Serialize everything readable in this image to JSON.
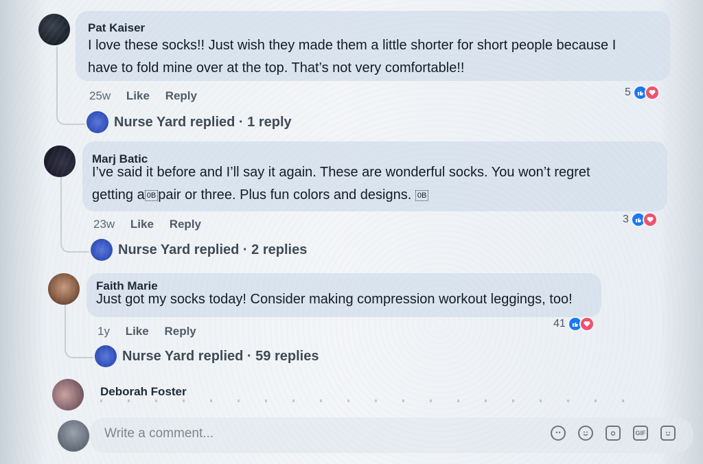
{
  "comments": [
    {
      "author": "Pat Kaiser",
      "text_line1": "I love these socks!! Just wish they made them a little shorter for short people because I",
      "text_line2": "have to fold mine over at the top. That’s not very comfortable!!",
      "time": "25w",
      "like": "Like",
      "reply": "Reply",
      "reaction_count": "5",
      "replies_text": "Nurse Yard replied · 1 reply"
    },
    {
      "author": "Marj Batic",
      "text_line1": "I’ve said it before and I’ll say it again. These are wonderful socks. You won’t regret",
      "text_line2_a": "getting a",
      "text_line2_b": "pair or three. Plus fun colors and designs.",
      "emoji_chip": "0B",
      "time": "23w",
      "like": "Like",
      "reply": "Reply",
      "reaction_count": "3",
      "replies_text": "Nurse Yard replied · 2 replies"
    },
    {
      "author": "Faith Marie",
      "text": "Just got my socks today! Consider making compression workout leggings, too!",
      "time": "1y",
      "like": "Like",
      "reply": "Reply",
      "reaction_count": "41",
      "replies_text": "Nurse Yard replied · 59 replies"
    },
    {
      "author": "Deborah Foster"
    }
  ],
  "composer": {
    "placeholder": "Write a comment...",
    "icons": [
      "emoji-face-icon",
      "smiley-icon",
      "camera-icon",
      "gif-icon",
      "sticker-icon"
    ],
    "gif_label": "GIF"
  },
  "colors": {
    "like_blue": "#1877f2",
    "love_red": "#f0506e"
  }
}
